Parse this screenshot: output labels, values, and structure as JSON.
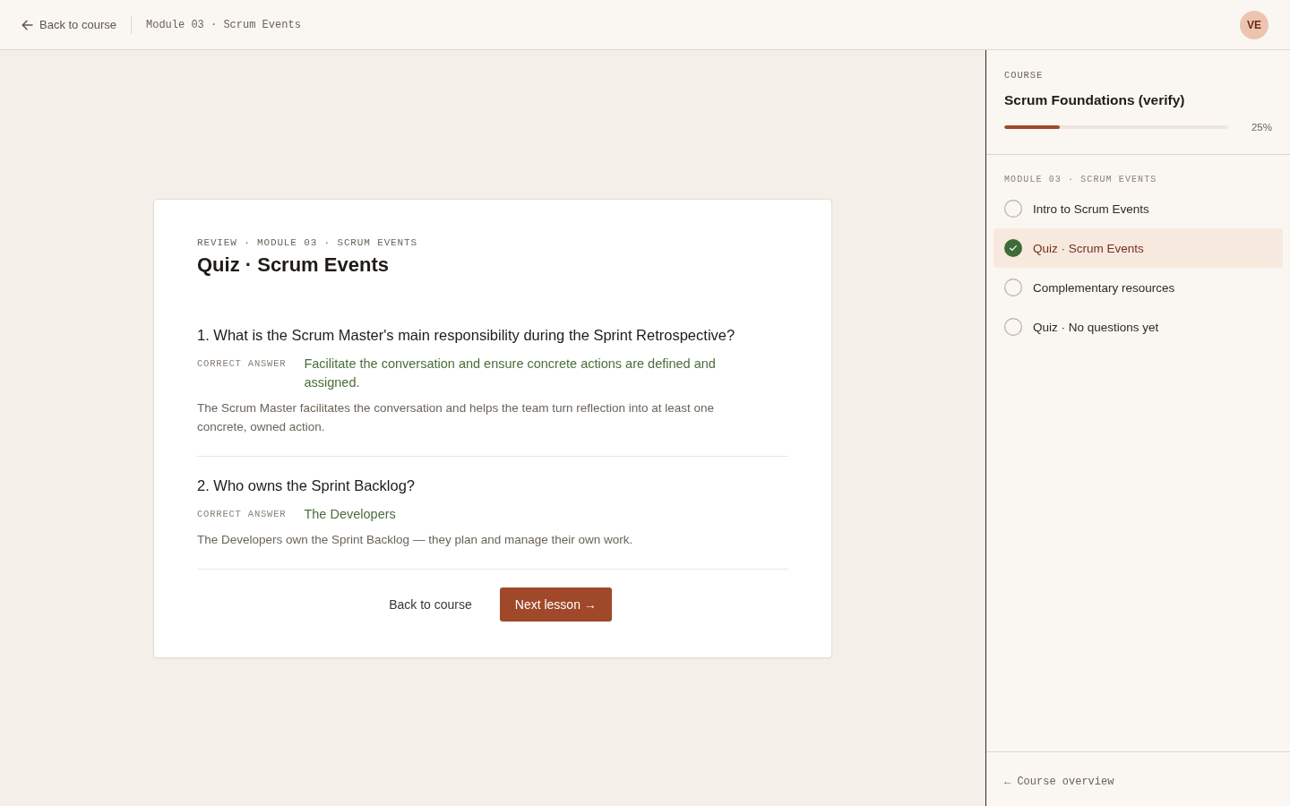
{
  "header": {
    "back_link": "Back to course",
    "breadcrumb": "Module 03 · Scrum Events",
    "avatar": "VE"
  },
  "quiz": {
    "eyebrow": "REVIEW · MODULE 03 · SCRUM EVENTS",
    "title": "Quiz · Scrum Events",
    "questions": [
      {
        "question": "1. What is the Scrum Master's main responsibility during the Sprint Retrospective?",
        "answer_label": "CORRECT ANSWER",
        "answer": "Facilitate the conversation and ensure concrete actions are defined and assigned.",
        "explanation": "The Scrum Master facilitates the conversation and helps the team turn reflection into at least one concrete, owned action."
      },
      {
        "question": "2. Who owns the Sprint Backlog?",
        "answer_label": "CORRECT ANSWER",
        "answer": "The Developers",
        "explanation": "The Developers own the Sprint Backlog — they plan and manage their own work."
      }
    ],
    "actions": {
      "back": "Back to course",
      "next": "Next lesson →"
    }
  },
  "sidebar": {
    "label": "COURSE",
    "course_title": "Scrum Foundations (verify)",
    "progress": {
      "level": 0.25,
      "reading": "25%"
    },
    "module_label": "MODULE 03 · SCRUM EVENTS",
    "lessons": [
      {
        "title": "Intro to Scrum Events",
        "done": false,
        "selected": false
      },
      {
        "title": "Quiz · Scrum Events",
        "done": true,
        "selected": true
      },
      {
        "title": "Complementary resources",
        "done": false,
        "selected": false
      },
      {
        "title": "Quiz · No questions yet",
        "done": false,
        "selected": false
      }
    ],
    "footer_link": "← Course overview"
  }
}
